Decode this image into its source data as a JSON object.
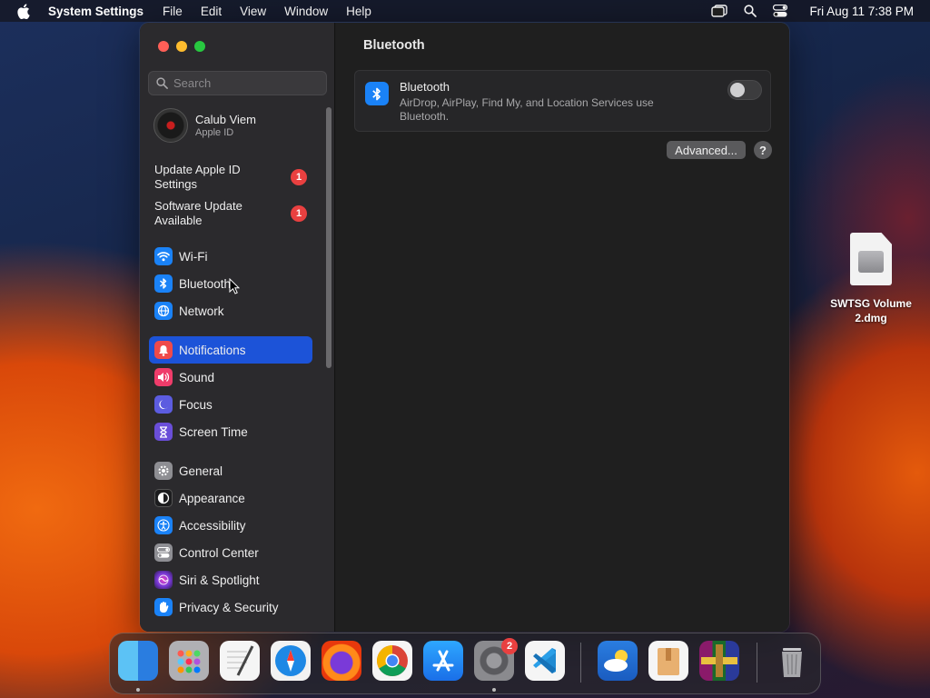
{
  "menubar": {
    "app_name": "System Settings",
    "items": [
      "File",
      "Edit",
      "View",
      "Window",
      "Help"
    ],
    "clock": "Fri Aug 11  7:38 PM"
  },
  "sidebar": {
    "search_placeholder": "Search",
    "account": {
      "name": "Calub Viem",
      "subtitle": "Apple ID"
    },
    "notices": [
      {
        "label": "Update Apple ID Settings",
        "badge": "1"
      },
      {
        "label": "Software Update Available",
        "badge": "1"
      }
    ],
    "items": [
      {
        "label": "Wi-Fi",
        "icon": "wifi-icon",
        "color": "#1a82f7"
      },
      {
        "label": "Bluetooth",
        "icon": "bluetooth-icon",
        "color": "#1a82f7"
      },
      {
        "label": "Network",
        "icon": "globe-icon",
        "color": "#1a82f7"
      },
      {
        "label": "Notifications",
        "icon": "bell-icon",
        "color": "#ef4a4a",
        "active": true
      },
      {
        "label": "Sound",
        "icon": "speaker-icon",
        "color": "#ef3c6a"
      },
      {
        "label": "Focus",
        "icon": "moon-icon",
        "color": "#5c5ce0"
      },
      {
        "label": "Screen Time",
        "icon": "hourglass-icon",
        "color": "#6a4ed8"
      },
      {
        "label": "General",
        "icon": "gear-icon",
        "color": "#8e8e93"
      },
      {
        "label": "Appearance",
        "icon": "appearance-icon",
        "color": "#1c1c1e"
      },
      {
        "label": "Accessibility",
        "icon": "accessibility-icon",
        "color": "#1a82f7"
      },
      {
        "label": "Control Center",
        "icon": "control-center-icon",
        "color": "#8e8e93"
      },
      {
        "label": "Siri & Spotlight",
        "icon": "siri-icon",
        "color": "#7a3ad8"
      },
      {
        "label": "Privacy & Security",
        "icon": "hand-icon",
        "color": "#1a82f7"
      }
    ]
  },
  "content": {
    "title": "Bluetooth",
    "card": {
      "title": "Bluetooth",
      "description": "AirDrop, AirPlay, Find My, and Location Services use Bluetooth.",
      "toggle_on": false
    },
    "advanced_label": "Advanced...",
    "help_label": "?"
  },
  "desktop": {
    "file_label": "SWTSG Volume 2.dmg"
  },
  "dock": {
    "apps": [
      "Finder",
      "Launchpad",
      "TextEdit",
      "Safari",
      "Firefox",
      "Chrome",
      "App Store",
      "System Settings",
      "Visual Studio Code",
      "Weather",
      "Archive",
      "WinRAR",
      "Trash"
    ],
    "settings_badge": "2"
  }
}
